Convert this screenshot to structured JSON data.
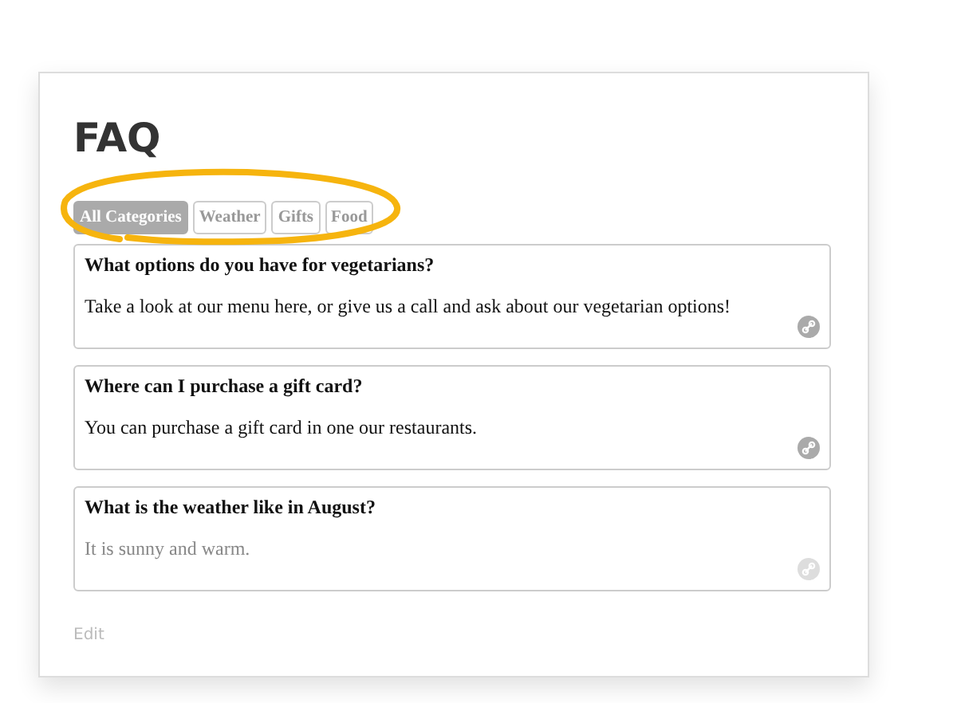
{
  "title": "FAQ",
  "tabs": [
    {
      "label": "All Categories",
      "selected": true
    },
    {
      "label": "Weather",
      "selected": false
    },
    {
      "label": "Gifts",
      "selected": false
    },
    {
      "label": "Food",
      "selected": false
    }
  ],
  "faqs": [
    {
      "question": "What options do you have for vegetarians?",
      "answer": "Take a look at our menu here, or give us a call and ask about our vegetarian options!",
      "faded": false
    },
    {
      "question": "Where can I purchase a gift card?",
      "answer": "You can purchase a gift card in one our restaurants.",
      "faded": false
    },
    {
      "question": "What is the weather like in August?",
      "answer": "It is sunny and warm.",
      "faded": true
    }
  ],
  "edit_link": "Edit"
}
